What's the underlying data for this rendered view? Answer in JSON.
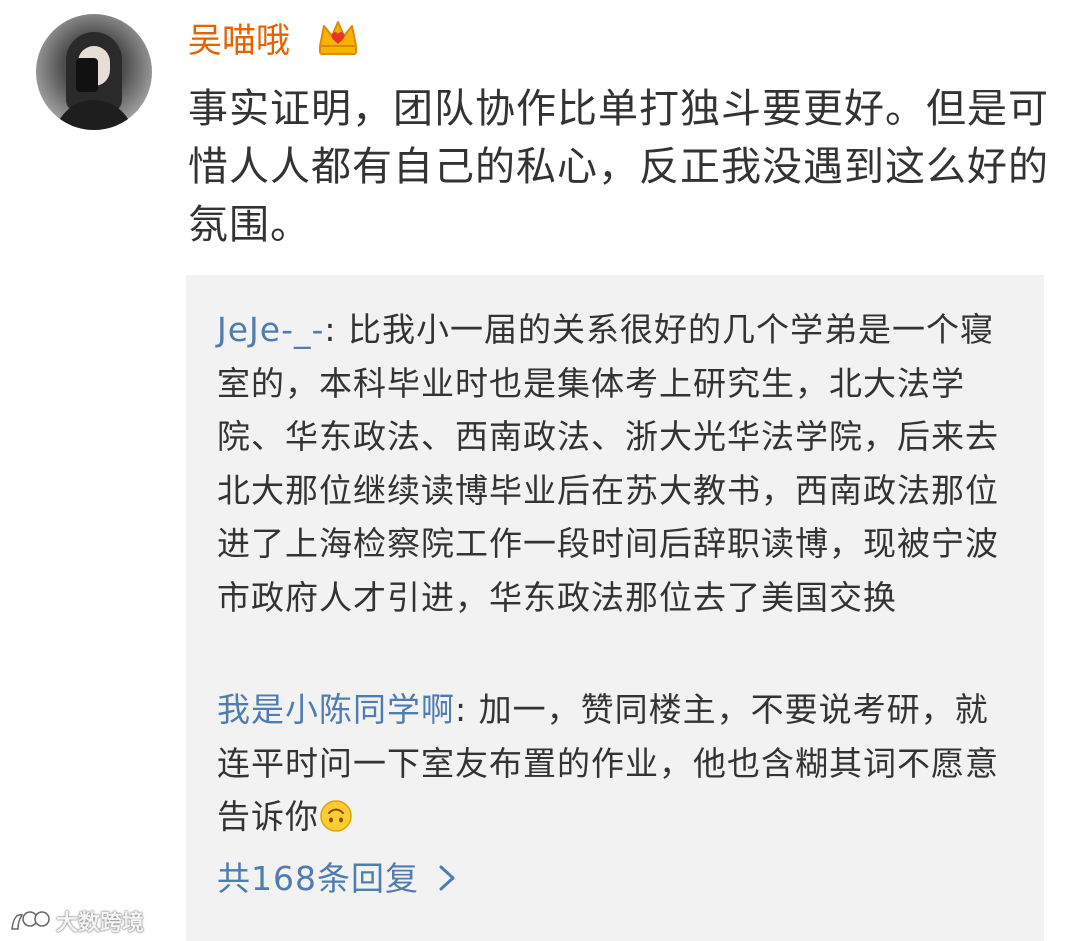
{
  "post": {
    "username": "吴喵哦",
    "badge_icon": "crown-icon",
    "text": "事实证明，团队协作比单打独斗要更好。但是可惜人人都有自己的私心，反正我没遇到这么好的氛围。"
  },
  "replies": [
    {
      "author": "JeJe-_-",
      "separator": ": ",
      "text": "比我小一届的关系很好的几个学弟是一个寝室的，本科毕业时也是集体考上研究生，北大法学院、华东政法、西南政法、浙大光华法学院，后来去北大那位继续读博毕业后在苏大教书，西南政法那位进了上海检察院工作一段时间后辞职读博，现被宁波市政府人才引进，华东政法那位去了美国交换"
    },
    {
      "author": "我是小陈同学啊",
      "separator": ": ",
      "text": "加一，赞同楼主，不要说考研，就连平时问一下室友布置的作业，他也含糊其词不愿意告诉你",
      "emoji": "upside-down-face-icon"
    }
  ],
  "more_replies_label": "共168条回复",
  "watermark": {
    "text": "大数跨境",
    "logo_icon": "watermark-logo-icon"
  },
  "colors": {
    "username": "#e66100",
    "link": "#507daf",
    "text": "#333333",
    "reply_bg": "#f2f2f2"
  }
}
